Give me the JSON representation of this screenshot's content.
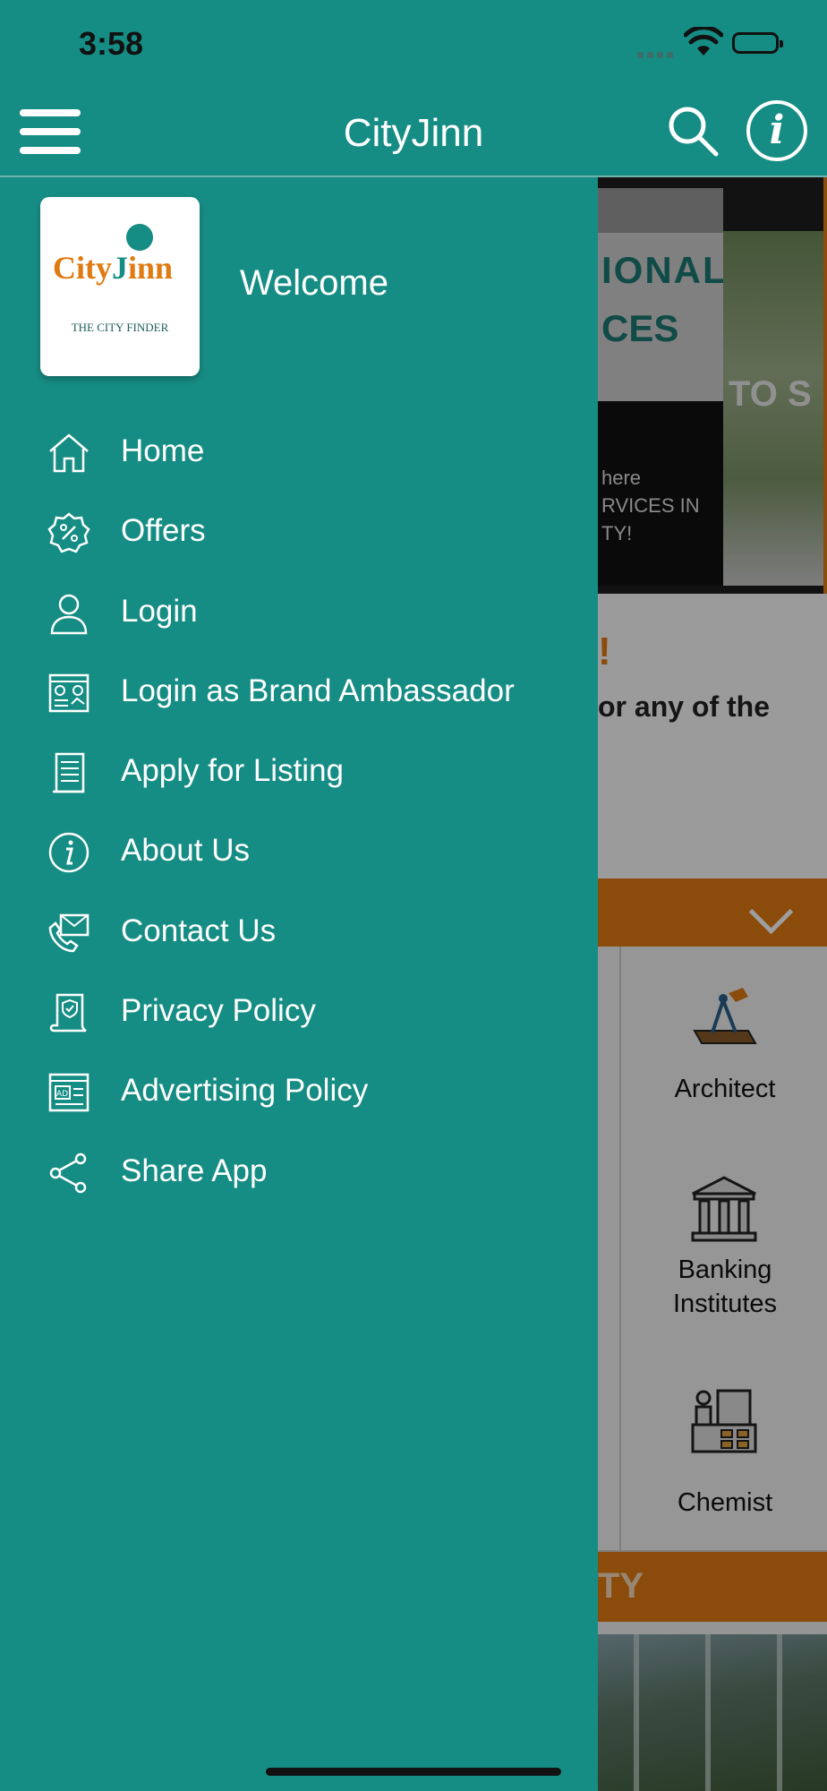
{
  "status_bar": {
    "time": "3:58"
  },
  "app_bar": {
    "title": "CityJinn"
  },
  "drawer": {
    "logo": {
      "word_left": "City",
      "word_right": "inn",
      "tagline": "THE CITY FINDER"
    },
    "welcome": "Welcome",
    "items": [
      {
        "label": "Home",
        "icon": "home-icon"
      },
      {
        "label": "Offers",
        "icon": "offers-badge-icon"
      },
      {
        "label": "Login",
        "icon": "user-icon"
      },
      {
        "label": "Login as Brand Ambassador",
        "icon": "brand-ambassador-icon"
      },
      {
        "label": "Apply for Listing",
        "icon": "document-list-icon"
      },
      {
        "label": "About Us",
        "icon": "info-icon"
      },
      {
        "label": "Contact Us",
        "icon": "contact-phone-mail-icon"
      },
      {
        "label": "Privacy Policy",
        "icon": "privacy-scroll-icon"
      },
      {
        "label": "Advertising Policy",
        "icon": "ad-window-icon"
      },
      {
        "label": "Share App",
        "icon": "share-icon"
      }
    ]
  },
  "background": {
    "banner_line1": "IONAL",
    "banner_line2": "CES",
    "banner_small1": "here",
    "banner_small2": "RVICES IN",
    "banner_small3": "TY!",
    "banner_right": "TO S",
    "intro_exclaim": "!",
    "intro_line": "or any of the",
    "categories": [
      "Architect",
      "Banking Institutes",
      "Chemist"
    ],
    "section_partial": "TY"
  },
  "colors": {
    "teal": "#168d84",
    "orange": "#e07a12"
  }
}
